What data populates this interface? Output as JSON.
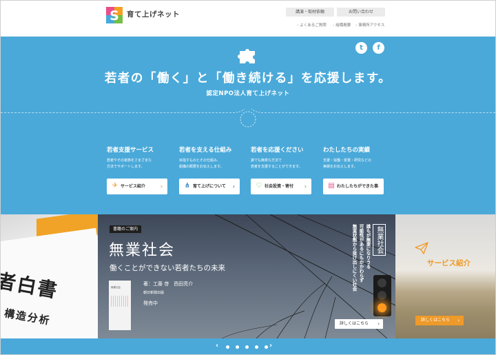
{
  "header": {
    "logo_text": "育て上げネット",
    "btn_lecture": "講演・取材依頼",
    "btn_contact": "お問い合わせ",
    "subnav": [
      "よくあるご質問",
      "組織概要",
      "事務所アクセス"
    ]
  },
  "hero": {
    "tagline": "若者の「働く」と「働き続ける」を応援します。",
    "subtagline": "認定NPO法人育て上げネット",
    "social": {
      "twitter": "t",
      "facebook": "f"
    },
    "columns": [
      {
        "title": "若者支援サービス",
        "desc": [
          "若者やその家族をさまざまな",
          "方法でサポートします。"
        ],
        "button": "サービス紹介",
        "icon": "paper-plane-icon",
        "color": "#f09a2a"
      },
      {
        "title": "若者を支える仕組み",
        "desc": [
          "目指すものとその仕組み、",
          "組織の概要をお伝えします。"
        ],
        "button": "育て上げについて",
        "icon": "network-icon",
        "color": "#3f86c6"
      },
      {
        "title": "若者を応援ください",
        "desc": [
          "誰でも簡単な方法で",
          "若者を支援することができます。"
        ],
        "button": "社会投資・寄付",
        "icon": "heart-icon",
        "color": "#6cc04a"
      },
      {
        "title": "わたしたちの実績",
        "desc": [
          "支援・協働・受賞・研究などの",
          "実績をお伝えします。"
        ],
        "button": "わたしたちができた事",
        "icon": "book-icon",
        "color": "#e8558a"
      }
    ]
  },
  "slider": {
    "left": {
      "line1": "者白書",
      "line2": "構造分析"
    },
    "main": {
      "badge": "書籍のご案内",
      "title": "無業社会",
      "subtitle": "働くことができない若者たちの未来",
      "authors": "著：工藤 啓　西田亮介",
      "publisher": "朝日新聞出版",
      "sale": "発売中",
      "cover_title": "無業社会",
      "vertical_title": "無業社会",
      "vertical_lines": [
        "誰もが無業になりうる",
        "可能性があるにもかかわらず",
        "無業状態から抜け出しにくい社会"
      ],
      "detail_button": "詳しくはこちら"
    },
    "right": {
      "title": "サービス紹介",
      "button": "詳しくはこちら"
    },
    "pager": {
      "prev": "‹",
      "next": "›",
      "count": 5
    }
  }
}
